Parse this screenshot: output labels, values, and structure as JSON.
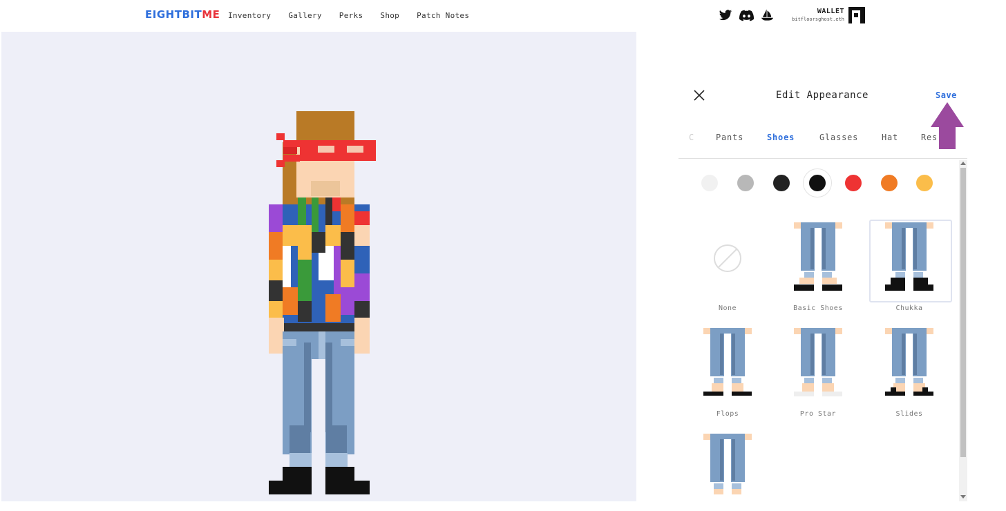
{
  "header": {
    "logo": {
      "part1": "EIGHT",
      "part2": "BIT",
      "part3": "ME"
    },
    "nav": [
      "Inventory",
      "Gallery",
      "Perks",
      "Shop",
      "Patch Notes"
    ],
    "social_icons": [
      "twitter-icon",
      "discord-icon",
      "opensea-icon"
    ],
    "wallet": {
      "label": "WALLET",
      "address": "bitfloorsghost.eth"
    }
  },
  "panel": {
    "title": "Edit Appearance",
    "save_label": "Save",
    "tabs": [
      {
        "label": "C",
        "state": "faded"
      },
      {
        "label": "Pants",
        "state": "normal"
      },
      {
        "label": "Shoes",
        "state": "active"
      },
      {
        "label": "Glasses",
        "state": "normal"
      },
      {
        "label": "Hat",
        "state": "normal"
      },
      {
        "label": "Res",
        "state": "normal"
      }
    ],
    "colors": [
      "#f1f1f1",
      "#b8b8b8",
      "#222222",
      "#111111",
      "#ee3333",
      "#f07b24",
      "#fbbd4a"
    ],
    "selected_color_index": 3,
    "items": [
      {
        "label": "None",
        "shoe": "none"
      },
      {
        "label": "Basic Shoes",
        "shoe": "basic"
      },
      {
        "label": "Chukka",
        "shoe": "chukka",
        "selected": true
      },
      {
        "label": "Flops",
        "shoe": "flops"
      },
      {
        "label": "Pro Star",
        "shoe": "prostar"
      },
      {
        "label": "Slides",
        "shoe": "slides"
      },
      {
        "label": "",
        "shoe": "partial"
      }
    ]
  },
  "annotation": {
    "arrow_color": "#9b4a9e"
  }
}
